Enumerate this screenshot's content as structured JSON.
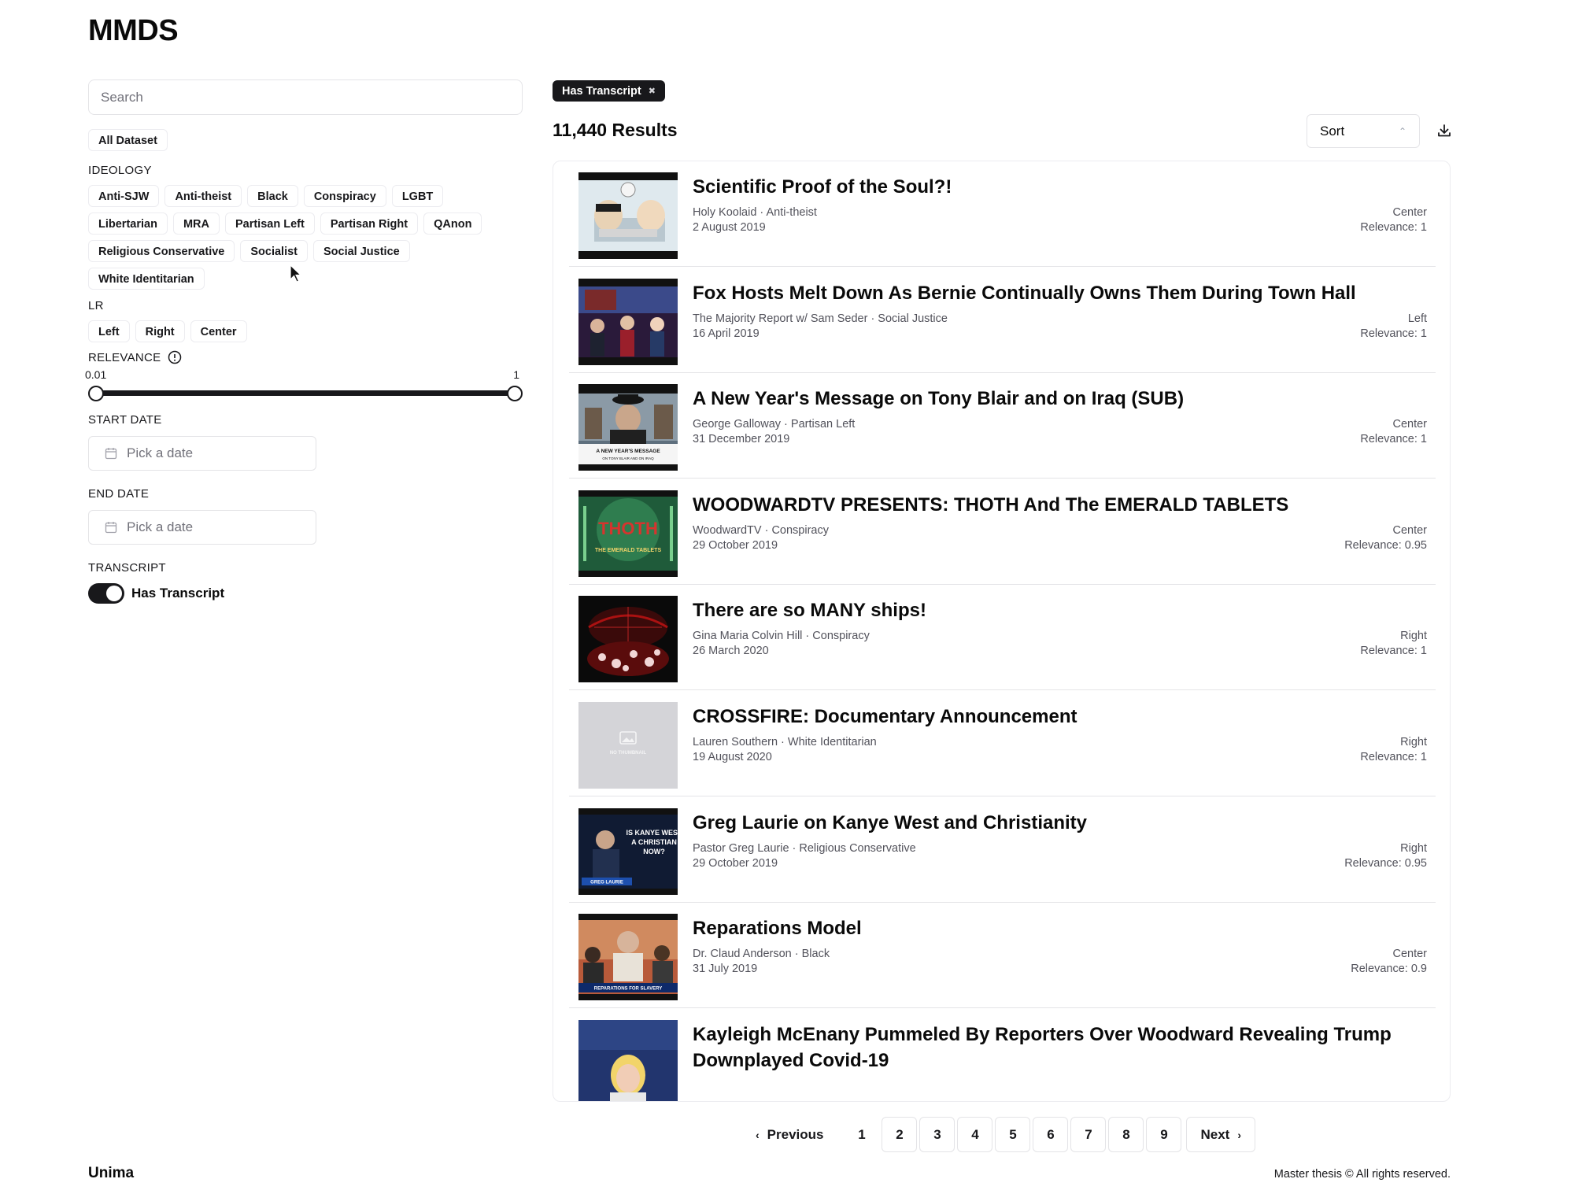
{
  "app": {
    "title": "MMDS"
  },
  "sidebar": {
    "search_placeholder": "Search",
    "dataset_chip": "All Dataset",
    "ideology": {
      "label": "IDEOLOGY",
      "rows": [
        [
          "Anti-SJW",
          "Anti-theist",
          "Black",
          "Conspiracy",
          "LGBT"
        ],
        [
          "Libertarian",
          "MRA",
          "Partisan Left",
          "Partisan Right",
          "QAnon"
        ],
        [
          "Religious Conservative",
          "Socialist",
          "Social Justice"
        ],
        [
          "White Identitarian"
        ]
      ]
    },
    "lr": {
      "label": "LR",
      "options": [
        "Left",
        "Right",
        "Center"
      ]
    },
    "relevance": {
      "label": "RELEVANCE",
      "min_label": "0.01",
      "max_label": "1",
      "min_value": 0.01,
      "max_value": 1,
      "info_icon": "info-circle-icon"
    },
    "start_date": {
      "label": "START DATE",
      "placeholder": "Pick a date",
      "icon": "calendar-icon"
    },
    "end_date": {
      "label": "END DATE",
      "placeholder": "Pick a date",
      "icon": "calendar-icon"
    },
    "transcript": {
      "label": "TRANSCRIPT",
      "toggle_label": "Has Transcript",
      "enabled": true
    }
  },
  "main": {
    "active_filter": "Has Transcript",
    "results_count": "11,440 Results",
    "sort_label": "Sort",
    "download_icon": "download-icon",
    "results": [
      {
        "title": "Scientific Proof of the Soul?!",
        "channel": "Holy Koolaid · Anti-theist",
        "date": "2 August 2019",
        "lr": "Center",
        "relevance": "Relevance: 1",
        "thumb": "cartoon"
      },
      {
        "title": "Fox Hosts Melt Down As Bernie Continually Owns Them During Town Hall",
        "channel": "The Majority Report w/ Sam Seder · Social Justice",
        "date": "16 April 2019",
        "lr": "Left",
        "relevance": "Relevance: 1",
        "thumb": "townhall"
      },
      {
        "title": "A New Year's Message on Tony Blair and on Iraq (SUB)",
        "channel": "George Galloway · Partisan Left",
        "date": "31 December 2019",
        "lr": "Center",
        "relevance": "Relevance: 1",
        "thumb": "galloway"
      },
      {
        "title": "WOODWARDTV PRESENTS: THOTH And The EMERALD TABLETS",
        "channel": "WoodwardTV · Conspiracy",
        "date": "29 October 2019",
        "lr": "Center",
        "relevance": "Relevance: 0.95",
        "thumb": "thoth"
      },
      {
        "title": "There are so MANY ships!",
        "channel": "Gina Maria Colvin Hill · Conspiracy",
        "date": "26 March 2020",
        "lr": "Right",
        "relevance": "Relevance: 1",
        "thumb": "ships"
      },
      {
        "title": "CROSSFIRE: Documentary Announcement",
        "channel": "Lauren Southern · White Identitarian",
        "date": "19 August 2020",
        "lr": "Right",
        "relevance": "Relevance: 1",
        "thumb": "none"
      },
      {
        "title": "Greg Laurie on Kanye West and Christianity",
        "channel": "Pastor Greg Laurie · Religious Conservative",
        "date": "29 October 2019",
        "lr": "Right",
        "relevance": "Relevance: 0.95",
        "thumb": "kanye"
      },
      {
        "title": "Reparations Model",
        "channel": "Dr. Claud Anderson · Black",
        "date": "31 July 2019",
        "lr": "Center",
        "relevance": "Relevance: 0.9",
        "thumb": "reparations"
      },
      {
        "title": "Kayleigh McEnany Pummeled By Reporters Over Woodward Revealing Trump Downplayed Covid-19",
        "channel": "",
        "date": "",
        "lr": "",
        "relevance": "",
        "thumb": "kayleigh"
      }
    ],
    "thumb_texts": {
      "galloway": "A NEW YEAR'S MESSAGE",
      "galloway_sub": "ON TONY BLAIR AND ON IRAQ",
      "thoth": "THOTH",
      "thoth_sub": "THE EMERALD TABLETS",
      "none": "NO THUMBNAIL",
      "kanye_l1": "IS KANYE WEST",
      "kanye_l2": "A CHRISTIAN",
      "kanye_l3": "NOW?",
      "kanye_bar": "GREG LAURIE",
      "reparations": "REPARATIONS FOR SLAVERY"
    },
    "pagination": {
      "prev": "Previous",
      "next": "Next",
      "pages": [
        "1",
        "2",
        "3",
        "4",
        "5",
        "6",
        "7",
        "8",
        "9"
      ],
      "current": "1"
    }
  },
  "footer": {
    "brand": "Unima",
    "copyright": "Master thesis © All rights reserved."
  }
}
